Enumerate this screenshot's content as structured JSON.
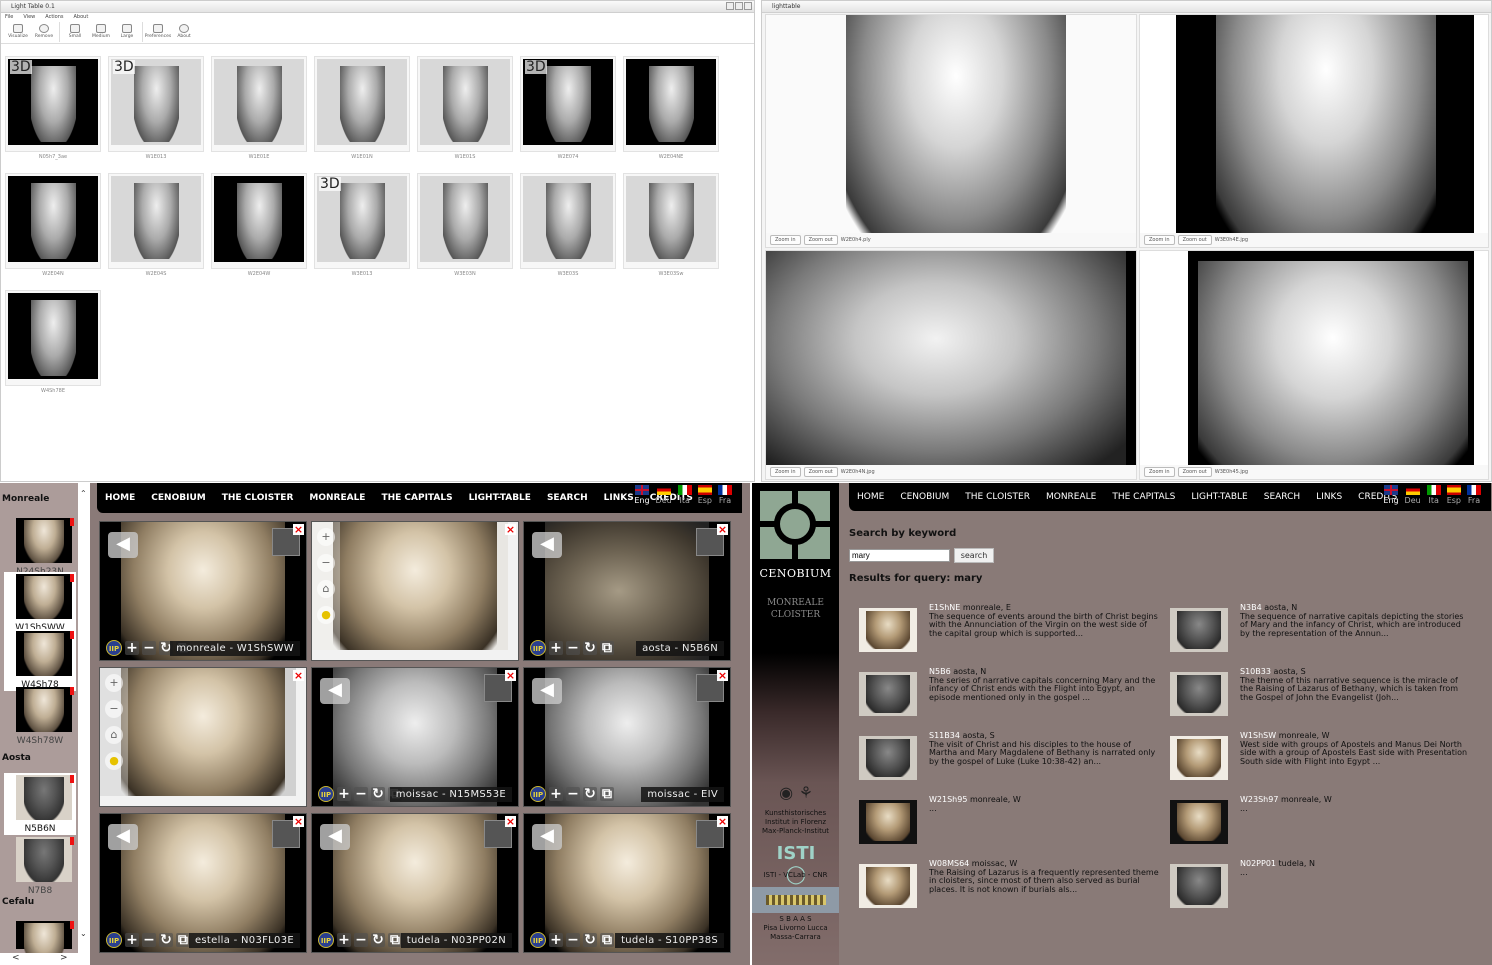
{
  "light_table": {
    "title": "Light Table 0.1",
    "menu": [
      "File",
      "View",
      "Actions",
      "About"
    ],
    "toolbar": [
      {
        "icon": "visualize-icon",
        "label": "Visualize"
      },
      {
        "icon": "remove-icon",
        "label": "Remove"
      },
      {
        "icon": "small-icon",
        "label": "Small"
      },
      {
        "icon": "medium-icon",
        "label": "Medium"
      },
      {
        "icon": "large-icon",
        "label": "Large"
      },
      {
        "icon": "preferences-icon",
        "label": "Preferences"
      },
      {
        "icon": "about-icon",
        "label": "About"
      }
    ],
    "thumbs": [
      {
        "badge": "3D",
        "caption": "N05h7_3ae"
      },
      {
        "badge": "3D",
        "caption": "W1E013"
      },
      {
        "badge": "",
        "caption": "W1E01E"
      },
      {
        "badge": "",
        "caption": "W1E01N"
      },
      {
        "badge": "",
        "caption": "W1E01S"
      },
      {
        "badge": "3D",
        "caption": "W2E074"
      },
      {
        "badge": "",
        "caption": "W2E04NE"
      },
      {
        "badge": "",
        "caption": "W2E04N"
      },
      {
        "badge": "",
        "caption": "W2E04S"
      },
      {
        "badge": "",
        "caption": "W2E04W"
      },
      {
        "badge": "3D",
        "caption": "W3E013"
      },
      {
        "badge": "",
        "caption": "W3E03N"
      },
      {
        "badge": "",
        "caption": "W3E03S"
      },
      {
        "badge": "",
        "caption": "W3E03Sw"
      },
      {
        "badge": "",
        "caption": "W4Sh78E"
      }
    ]
  },
  "lightbox": {
    "title": "lighttable",
    "zoom_in": "Zoom in",
    "zoom_out": "Zoom out",
    "panes": [
      {
        "file": "W2E0h4.ply"
      },
      {
        "file": "W3E0h4E.jpg"
      },
      {
        "file": "W2E0h4N.jpg"
      },
      {
        "file": "W3E0h45.jpg"
      }
    ]
  },
  "cenobium_viewer": {
    "nav": [
      "HOME",
      "CENOBIUM",
      "THE CLOISTER",
      "MONREALE",
      "THE CAPITALS",
      "LIGHT-TABLE",
      "SEARCH",
      "LINKS",
      "CREDITS"
    ],
    "languages": [
      {
        "code": "Eng",
        "active": true
      },
      {
        "code": "Deu",
        "active": false
      },
      {
        "code": "Ita",
        "active": false
      },
      {
        "code": "Esp",
        "active": false
      },
      {
        "code": "Fra",
        "active": false
      }
    ],
    "sidebar": {
      "groups": [
        {
          "name": "Monreale",
          "items": [
            {
              "label": "N24Sh23N",
              "selected": false
            },
            {
              "label": "W1ShSWW",
              "selected": true
            },
            {
              "label": "W4Sh78",
              "selected": true
            },
            {
              "label": "W4Sh78W",
              "selected": false
            }
          ]
        },
        {
          "name": "Aosta",
          "items": [
            {
              "label": "N5B6N",
              "selected": true
            },
            {
              "label": "N7B8",
              "selected": false
            }
          ]
        },
        {
          "name": "Cefalu",
          "items": []
        }
      ]
    },
    "tiles": [
      {
        "label": "monreale - W1ShSWW"
      },
      {
        "label": ""
      },
      {
        "label": "aosta - N5B6N"
      },
      {
        "label": ""
      },
      {
        "label": "moissac - N15MS53E"
      },
      {
        "label": "moissac - EIV"
      },
      {
        "label": "estella - N03FL03E"
      },
      {
        "label": "tudela - N03PP02N"
      },
      {
        "label": "tudela - S10PP38S"
      }
    ],
    "iip_label": "IIP"
  },
  "cenobium_search": {
    "brand": {
      "name": "CENOBIUM",
      "subtitle_1": "MONREALE",
      "subtitle_2": "CLOISTER"
    },
    "institutions": [
      {
        "lines": [
          "Kunsthistorisches",
          "Institut in Florenz",
          "Max-Planck-Institut"
        ]
      },
      {
        "lines": [
          "ISTI - VCLab - CNR"
        ]
      },
      {
        "lines": [
          "S B A A S",
          "Pisa Livorno Lucca",
          "Massa-Carrara"
        ]
      }
    ],
    "heading": "Search by keyword",
    "query": "mary",
    "button": "search",
    "results_heading": "Results for query: mary",
    "results": [
      {
        "code": "E1ShNE",
        "loc": "monreale, E",
        "text": "The sequence of events around the birth of Christ begins with the Annunciation of the Virgin on the west side of the capital group which is supported..."
      },
      {
        "code": "N3B4",
        "loc": "aosta, N",
        "text": "The sequence of narrative capitals depicting the stories of Mary and the infancy of Christ, which are introduced by the representation of the Annun..."
      },
      {
        "code": "N5B6",
        "loc": "aosta, N",
        "text": "The series of narrative capitals concerning Mary and the infancy of Christ ends with the Flight into Egypt, an episode mentioned only in the gospel ..."
      },
      {
        "code": "S10B33",
        "loc": "aosta, S",
        "text": "The theme of this narrative sequence is the miracle of the Raising of Lazarus of Bethany, which is taken from the Gospel of John the Evangelist (Joh..."
      },
      {
        "code": "S11B34",
        "loc": "aosta, S",
        "text": "The visit of Christ and his disciples to the house of Martha and Mary Magdalene of Bethany is narrated only by the gospel of Luke (Luke 10:38-42) an..."
      },
      {
        "code": "W1ShSW",
        "loc": "monreale, W",
        "text": "West side with groups of Apostels and Manus Dei North side with a group of Apostels East side with Presentation South side with Flight into Egypt ..."
      },
      {
        "code": "W21Sh95",
        "loc": "monreale, W",
        "text": "..."
      },
      {
        "code": "W23Sh97",
        "loc": "monreale, W",
        "text": "..."
      },
      {
        "code": "W08MS64",
        "loc": "moissac, W",
        "text": "The Raising of Lazarus is a frequently represented theme in cloisters, since most of them also served as burial places. It is not known if burials als..."
      },
      {
        "code": "N02PP01",
        "loc": "tudela, N",
        "text": "..."
      }
    ]
  }
}
